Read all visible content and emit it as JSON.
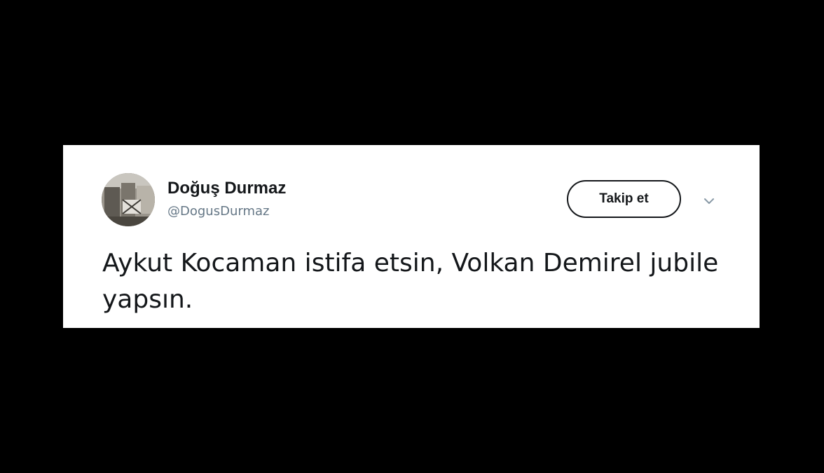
{
  "tweet": {
    "author": {
      "display_name": "Doğuş Durmaz",
      "handle": "@DogusDurmaz",
      "avatar_icon": "profile-photo"
    },
    "follow_button_label": "Takip et",
    "menu_icon": "chevron-down-icon",
    "text": "Aykut Kocaman istifa etsin, Volkan Demirel jubile yapsın."
  },
  "colors": {
    "background": "#000000",
    "card": "#ffffff",
    "text_primary": "#14171a",
    "text_secondary": "#657786"
  }
}
